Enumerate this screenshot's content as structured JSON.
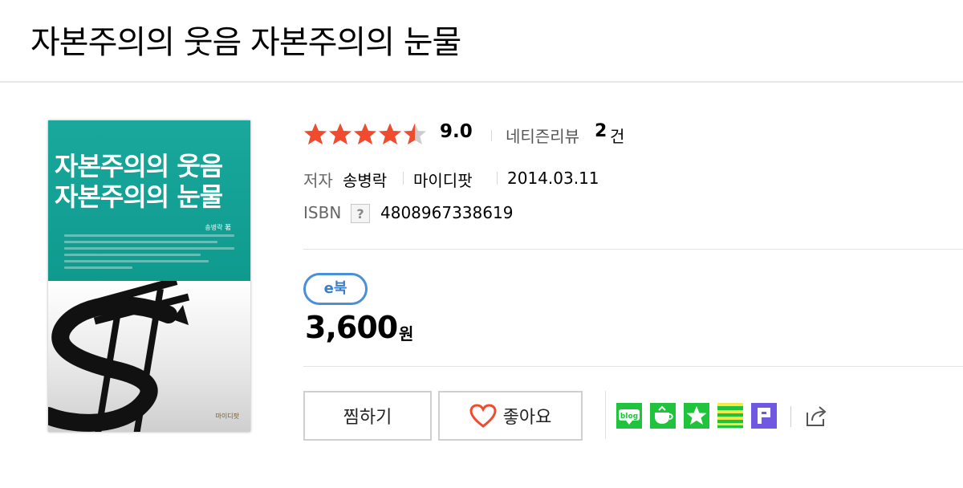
{
  "title": "자본주의의 웃음 자본주의의 눈물",
  "cover": {
    "title_line1": "자본주의의 웃음",
    "title_line2": "자본주의의 눈물",
    "author": "송병락 著",
    "publisher": "마이디팟"
  },
  "rating": {
    "stars": 4.5,
    "score": "9.0",
    "review_label": "네티즌리뷰",
    "review_count": "2",
    "review_unit": "건"
  },
  "meta": {
    "author_label": "저자",
    "author": "송병락",
    "publisher": "마이디팟",
    "date": "2014.03.11",
    "isbn_label": "ISBN",
    "isbn_help": "?",
    "isbn": "4808967338619"
  },
  "price": {
    "badge": "e북",
    "amount": "3,600",
    "unit": "원"
  },
  "actions": {
    "wish": "찜하기",
    "like": "좋아요"
  },
  "share": {
    "icons": [
      "blog-icon",
      "cafe-icon",
      "bookmark-star-icon",
      "band-icon",
      "post-icon",
      "share-icon"
    ]
  },
  "colors": {
    "star": "#f04a2f",
    "star_empty": "#cccccc",
    "badge": "#4a90d9",
    "cover_teal": "#13a295",
    "heart": "#f04a2f",
    "naver_green": "#1fc33c",
    "post_purple": "#7158e2"
  }
}
